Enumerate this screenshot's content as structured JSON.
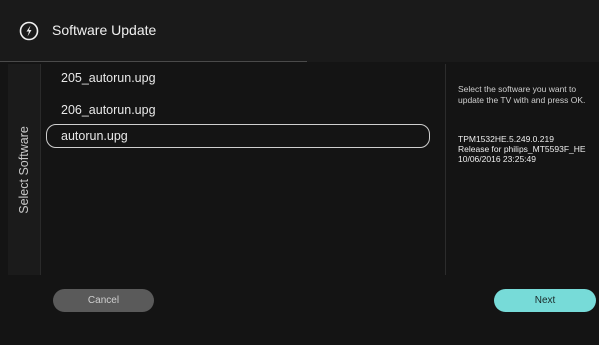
{
  "header": {
    "title": "Software Update",
    "icon": "update-icon"
  },
  "side_tab": {
    "label": "Select Software"
  },
  "file_list": {
    "items": [
      {
        "label": "205_autorun.upg",
        "selected": false
      },
      {
        "label": "206_autorun.upg",
        "selected": false
      },
      {
        "label": "autorun.upg",
        "selected": true
      }
    ]
  },
  "info_panel": {
    "instruction": "Select the software you want to update the TV with and press OK.",
    "version": "TPM1532HE.5.249.0.219",
    "release": "Release for philips_MT5593F_HE",
    "timestamp": "10/06/2016 23:25:49"
  },
  "buttons": {
    "cancel_label": "Cancel",
    "next_label": "Next"
  },
  "colors": {
    "accent": "#77dbd8",
    "background": "#141414",
    "header": "#1a1a1a",
    "button_inactive": "#5a5a5a"
  }
}
